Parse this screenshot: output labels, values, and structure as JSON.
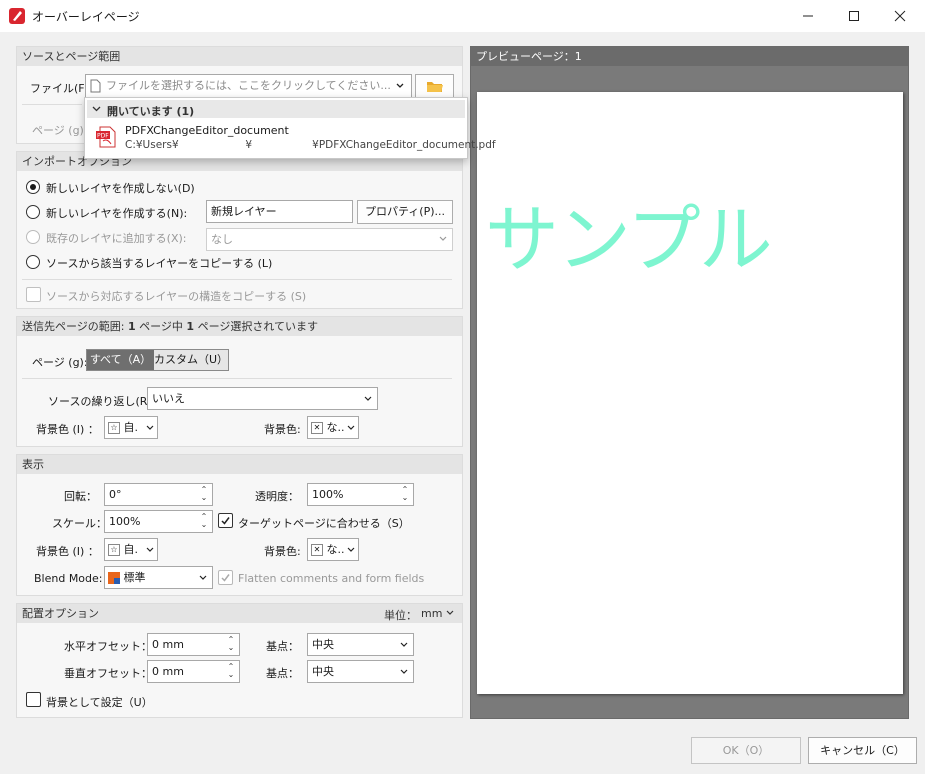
{
  "window": {
    "title": "オーバーレイページ"
  },
  "source": {
    "header": "ソースとページ範囲",
    "file_label": "ファイル(F):",
    "file_placeholder": "ファイルを選択するには、ここをクリックしてください...",
    "page_label": "ページ (g):"
  },
  "dropdown": {
    "group_label": "開いています (1)",
    "item_name": "PDFXChangeEditor_document",
    "item_path": "C:¥Users¥                    ¥                  ¥PDFXChangeEditor_document.pdf",
    "pdf_badge": "PDF"
  },
  "import": {
    "header": "インポートオプション",
    "opt1": "新しいレイヤを作成しない(D)",
    "opt2": "新しいレイヤを作成する(N):",
    "layer_name": "新規レイヤー",
    "properties_button": "プロパティ(P)...",
    "opt3": "既存のレイヤに追加する(X):",
    "existing_value": "なし",
    "opt4": "ソースから該当するレイヤーをコピーする (L)",
    "copy_structure": "ソースから対応するレイヤーの構造をコピーする (S)"
  },
  "dest": {
    "header_prefix": "送信先ページの範囲: ",
    "header_n1": "1",
    "header_mid": " ページ中 ",
    "header_n2": "1",
    "header_suffix": " ページ選択されています",
    "page_label": "ページ (g):",
    "tab_all": "すべて（A）",
    "tab_custom": "カスタム（U）",
    "repeat_label": "ソースの繰り返し(R):",
    "repeat_value": "いいえ",
    "bg1_label": "背景色 (I) ：",
    "bg1_value": "自.",
    "bg2_label": "背景色:",
    "bg2_value": "な.."
  },
  "display": {
    "header": "表示",
    "rotation_label": "回転：",
    "rotation_value": "0°",
    "opacity_label": "透明度：",
    "opacity_value": "100%",
    "scale_label": "スケール：",
    "scale_value": "100%",
    "fit_label": "ターゲットページに合わせる（S）",
    "bg1_label": "背景色 (I) ：",
    "bg1_value": "自.",
    "bg2_label": "背景色:",
    "bg2_value": "な..",
    "blend_label": "Blend Mode:",
    "blend_value": "標準",
    "flatten_label": "Flatten comments and form fields"
  },
  "placement": {
    "header": "配置オプション",
    "unit_label": "単位：",
    "unit_value": "mm",
    "hoffset_label": "水平オフセット：",
    "hoffset_value": "0 mm",
    "voffset_label": "垂直オフセット：",
    "voffset_value": "0 mm",
    "anchor_label": "基点：",
    "anchor1_value": "中央",
    "anchor2_value": "中央",
    "as_background": "背景として設定（U）"
  },
  "preview": {
    "header": "プレビューページ：1",
    "sample_text": "サンプル",
    "sample_color": "#7ef5d0"
  },
  "footer": {
    "ok": "OK（O）",
    "cancel": "キャンセル（C）"
  }
}
